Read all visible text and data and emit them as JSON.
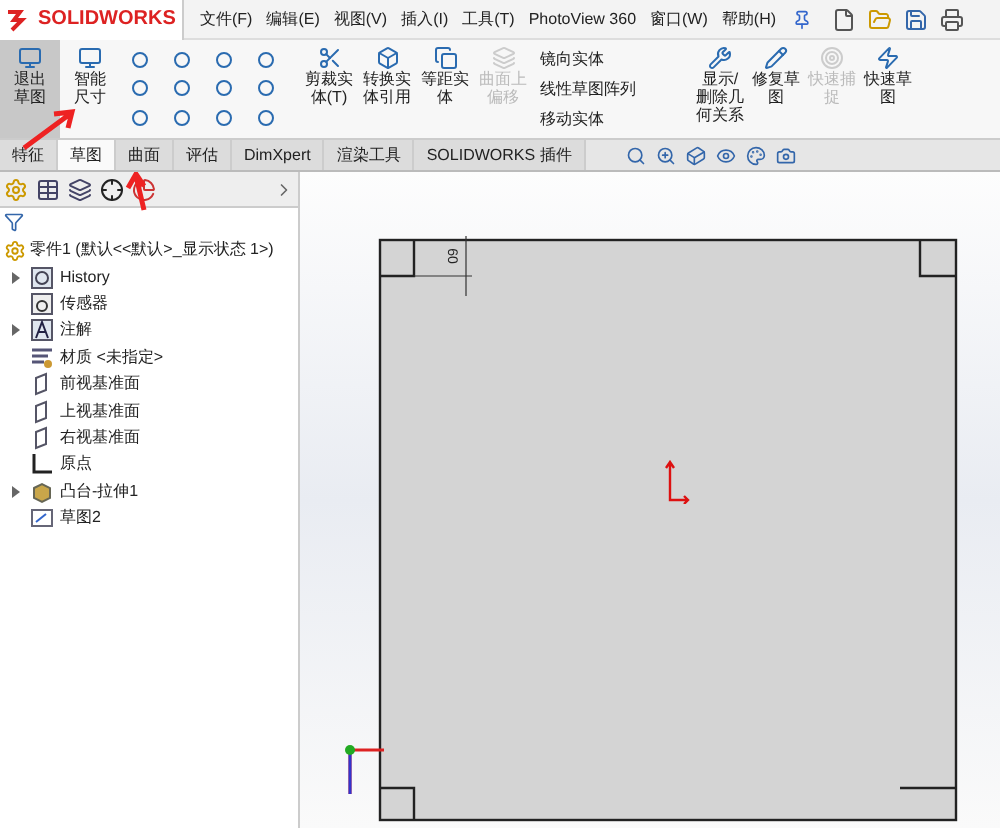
{
  "app": {
    "logo": "SOLIDWORKS"
  },
  "menu": [
    "文件(F)",
    "编辑(E)",
    "视图(V)",
    "插入(I)",
    "工具(T)",
    "PhotoView 360",
    "窗口(W)",
    "帮助(H)"
  ],
  "ribbon": {
    "large": [
      {
        "label": "退出草图",
        "selected": true,
        "disabled": false
      },
      {
        "label": "智能尺寸",
        "selected": false,
        "disabled": false
      }
    ],
    "medium": [
      {
        "label": "剪裁实体(T)",
        "disabled": false
      },
      {
        "label": "转换实体引用",
        "disabled": false
      },
      {
        "label": "等距实体",
        "disabled": false
      },
      {
        "label": "曲面上偏移",
        "disabled": true
      }
    ],
    "list": [
      "镜向实体",
      "线性草图阵列",
      "移动实体"
    ],
    "right": [
      {
        "label": "显示/删除几何关系",
        "disabled": false
      },
      {
        "label": "修复草图",
        "disabled": false
      },
      {
        "label": "快速捕捉",
        "disabled": true
      },
      {
        "label": "快速草图",
        "disabled": false
      }
    ]
  },
  "tabs": [
    {
      "label": "特征",
      "selected": false
    },
    {
      "label": "草图",
      "selected": true
    },
    {
      "label": "曲面",
      "selected": false
    },
    {
      "label": "评估",
      "selected": false
    },
    {
      "label": "DimXpert",
      "selected": false
    },
    {
      "label": "渲染工具",
      "selected": false
    },
    {
      "label": "SOLIDWORKS 插件",
      "selected": false
    }
  ],
  "tree": {
    "root": "零件1 (默认<<默认>_显示状态 1>)",
    "items": [
      {
        "label": "History",
        "kind": "history",
        "collapsed": true
      },
      {
        "label": "传感器",
        "kind": "sensor",
        "collapsed": false
      },
      {
        "label": "注解",
        "kind": "annotation",
        "collapsed": true
      },
      {
        "label": "材质 <未指定>",
        "kind": "material",
        "collapsed": false
      },
      {
        "label": "前视基准面",
        "kind": "plane",
        "collapsed": false
      },
      {
        "label": "上视基准面",
        "kind": "plane",
        "collapsed": false
      },
      {
        "label": "右视基准面",
        "kind": "plane",
        "collapsed": false
      },
      {
        "label": "原点",
        "kind": "origin",
        "collapsed": false
      },
      {
        "label": "凸台-拉伸1",
        "kind": "feature",
        "collapsed": true
      },
      {
        "label": "草图2",
        "kind": "sketch",
        "collapsed": false
      }
    ]
  },
  "canvas": {
    "dimension": "60"
  }
}
